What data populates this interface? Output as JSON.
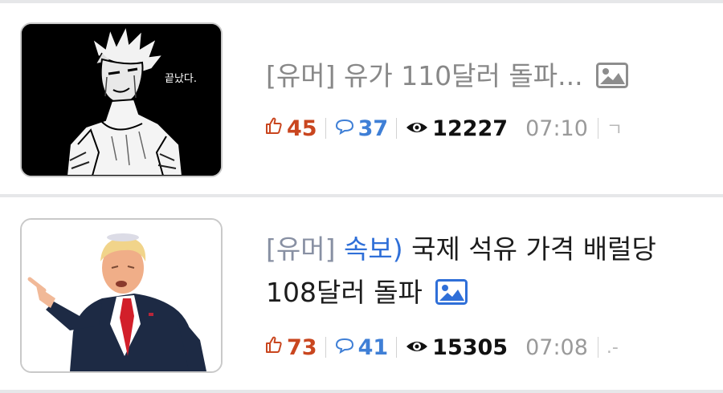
{
  "posts": [
    {
      "tag": "[유머]",
      "prefix": "",
      "title_line1": "유가 110달러 돌파...",
      "title_line2": "",
      "likes": "45",
      "comments": "37",
      "views": "12227",
      "time": "07:10",
      "trailing": "ㄱ",
      "thumbnail_caption": "끝났다.",
      "title_faded": true
    },
    {
      "tag": "[유머]",
      "prefix": "속보)",
      "title_line1": "국제 석유 가격 배럴당",
      "title_line2": "108달러 돌파",
      "likes": "73",
      "comments": "41",
      "views": "15305",
      "time": "07:08",
      "trailing": ".-",
      "thumbnail_caption": "",
      "title_faded": false
    }
  ],
  "colors": {
    "like": "#c9461f",
    "comment": "#3f7fd6",
    "tag": "#7d8899",
    "prefix": "#2f6fd8",
    "divider": "#e6e7e9"
  },
  "icons": {
    "like": "thumbs-up-icon",
    "comment": "speech-bubble-icon",
    "views": "eye-icon",
    "image": "image-icon"
  }
}
